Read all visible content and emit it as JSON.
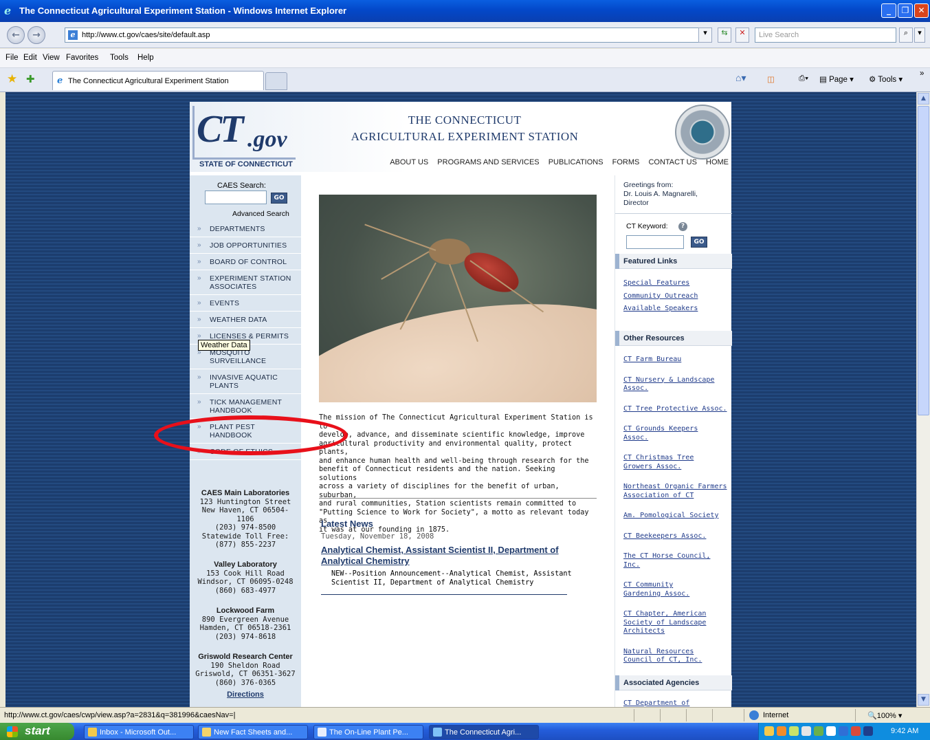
{
  "window": {
    "title": "The Connecticut Agricultural Experiment Station - Windows Internet Explorer",
    "controls": [
      "minimize",
      "maximize",
      "close"
    ]
  },
  "address_bar": {
    "url": "http://www.ct.gov/caes/site/default.asp",
    "search_placeholder": "Live Search"
  },
  "menu": [
    "File",
    "Edit",
    "View",
    "Favorites",
    "Tools",
    "Help"
  ],
  "tabs": [
    {
      "label": "The Connecticut Agricultural Experiment Station"
    }
  ],
  "command_bar": {
    "page": "Page",
    "tools": "Tools"
  },
  "site": {
    "logo_ct": "CT",
    "logo_gov": ".gov",
    "state": "STATE OF CONNECTICUT",
    "title_line1": "THE CONNECTICUT",
    "title_line2": "AGRICULTURAL EXPERIMENT STATION",
    "top_nav": [
      "ABOUT US",
      "PROGRAMS AND SERVICES",
      "PUBLICATIONS",
      "FORMS",
      "CONTACT US",
      "HOME"
    ]
  },
  "left": {
    "search_label": "CAES Search:",
    "go": "GO",
    "advanced": "Advanced Search",
    "nav": [
      "DEPARTMENTS",
      "JOB OPPORTUNITIES",
      "BOARD OF CONTROL",
      "EXPERIMENT STATION ASSOCIATES",
      "EVENTS",
      "WEATHER DATA",
      "LICENSES & PERMITS",
      "MOSQUITO SURVEILLANCE",
      "INVASIVE AQUATIC PLANTS",
      "TICK MANAGEMENT HANDBOOK",
      "PLANT PEST HANDBOOK",
      "CODE OF ETHICS"
    ],
    "tooltip": "Weather Data",
    "addresses": [
      {
        "name": "CAES Main Laboratories",
        "lines": [
          "123 Huntington Street",
          "New Haven, CT 06504-",
          "1106",
          "(203) 974-8500",
          "Statewide Toll Free:",
          "(877) 855-2237"
        ]
      },
      {
        "name": "Valley Laboratory",
        "lines": [
          "153 Cook Hill Road",
          "Windsor, CT 06095-0248",
          "(860) 683-4977"
        ]
      },
      {
        "name": "Lockwood Farm",
        "lines": [
          "890 Evergreen Avenue",
          "Hamden, CT 06518-2361",
          "(203) 974-8618"
        ]
      },
      {
        "name": "Griswold Research Center",
        "lines": [
          "190 Sheldon Road",
          "Griswold, CT 06351-3627",
          "(860) 376-0365"
        ]
      }
    ],
    "directions": "Directions"
  },
  "center": {
    "mission_lines": [
      "The mission of The Connecticut Agricultural Experiment Station is to",
      "develop, advance, and disseminate scientific knowledge, improve",
      "agricultural productivity and environmental quality, protect plants,",
      "and enhance human health and well-being through research for the",
      "benefit of Connecticut residents and the nation.  Seeking solutions",
      "across a variety of disciplines for the benefit of urban, suburban,",
      "and rural communities, Station scientists remain committed to",
      "\"Putting Science to Work for Society\", a motto as relevant today as",
      "it was at our founding in 1875."
    ],
    "news_heading": "Latest News",
    "news_date": "Tuesday, November 18, 2008",
    "news_title": "Analytical Chemist, Assistant Scientist II, Department of Analytical Chemistry",
    "news_body": "NEW--Position Announcement--Analytical Chemist, Assistant Scientist II, Department of Analytical Chemistry"
  },
  "right": {
    "greeting_lines": [
      "Greetings from:",
      "Dr. Louis A. Magnarelli,",
      "Director"
    ],
    "keyword_label": "CT Keyword:",
    "go": "GO",
    "featured_heading": "Featured Links",
    "featured": [
      "Special Features",
      "Community Outreach",
      "Available Speakers"
    ],
    "other_heading": "Other Resources",
    "other": [
      "CT Farm Bureau",
      "CT Nursery & Landscape Assoc.",
      "CT Tree Protective Assoc.",
      "CT Grounds Keepers Assoc.",
      "CT Christmas Tree Growers Assoc.",
      "Northeast Organic Farmers Association of CT",
      "Am. Pomological Society",
      "CT Beekeepers Assoc.",
      "The CT Horse Council, Inc.",
      "CT Community Gardening Assoc.",
      "CT Chapter, American Society of Landscape Architects",
      "Natural Resources Council of CT, Inc."
    ],
    "agencies_heading": "Associated Agencies",
    "agencies_partial": "CT Department of"
  },
  "status": {
    "url": "http://www.ct.gov/caes/cwp/view.asp?a=2831&q=381996&caesNav=|",
    "zone": "Internet",
    "zoom": "100%"
  },
  "taskbar": {
    "start": "start",
    "tasks": [
      "Inbox - Microsoft Out...",
      "New Fact Sheets and...",
      "The On-Line Plant Pe...",
      "The Connecticut Agri..."
    ],
    "clock": "9:42 AM"
  },
  "colors": {
    "navy": "#1f3a6b",
    "annotation": "#e8101a",
    "left_bg": "#dce6f0"
  }
}
